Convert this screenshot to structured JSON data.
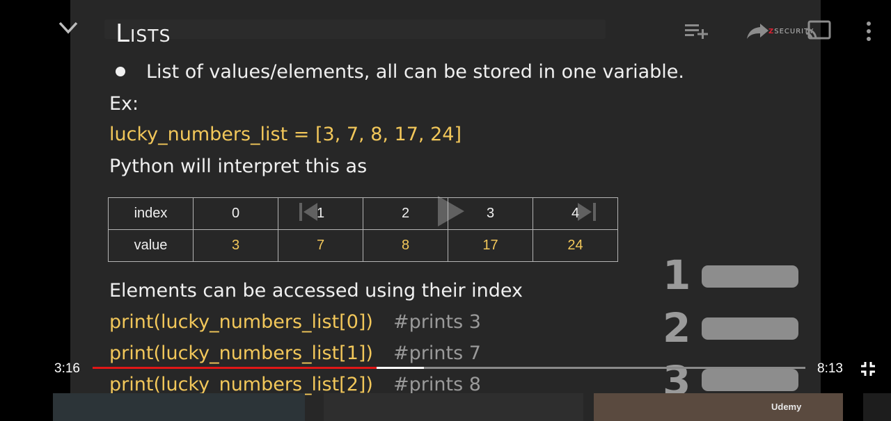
{
  "slide": {
    "title": "Lists",
    "bullet": "List of values/elements, all can be stored in one variable.",
    "ex_label": "Ex:",
    "code_line": "lucky_numbers_list = [3, 7, 8, 17, 24]",
    "interpret_line": "Python will interpret this as",
    "table": {
      "index_label": "index",
      "value_label": "value",
      "indices": [
        "0",
        "1",
        "2",
        "3",
        "4"
      ],
      "values": [
        "3",
        "7",
        "8",
        "17",
        "24"
      ]
    },
    "access_line": "Elements can be accessed using their index",
    "examples": [
      {
        "code": "print(lucky_numbers_list[0])",
        "comment": "#prints 3"
      },
      {
        "code": "print(lucky_numbers_list[1])",
        "comment": "#prints 7"
      },
      {
        "code": "print(lucky_numbers_list[2])",
        "comment": "#prints 8"
      }
    ],
    "numbered_graphic": [
      "1",
      "2",
      "3"
    ]
  },
  "player": {
    "current_time": "3:16",
    "duration": "8:13",
    "progress": 0.398,
    "buffered": 0.465,
    "brand_label": "SECURITY",
    "brand_letter": "Z",
    "thumbnail_brand": "Udemy"
  },
  "icons": {
    "minimize": "chevron-down-icon",
    "queue": "add-to-queue-icon",
    "share": "share-icon",
    "cast": "cast-icon",
    "more": "more-vertical-icon",
    "fullscreen_exit": "exit-fullscreen-icon"
  },
  "colors": {
    "code_yellow": "#f2c75a",
    "progress_red": "#e01717",
    "slide_bg": "#272727"
  }
}
